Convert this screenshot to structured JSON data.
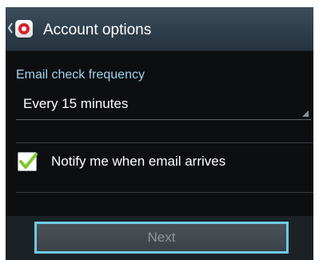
{
  "action_bar": {
    "title": "Account options",
    "back_icon": "chevron-left-icon",
    "app_icon": "email-app-icon"
  },
  "settings": {
    "email_check_frequency": {
      "label": "Email check frequency",
      "selected_value": "Every 15 minutes"
    },
    "notify_new_email": {
      "label": "Notify me when email arrives",
      "checked": true
    }
  },
  "footer": {
    "next_label": "Next",
    "next_enabled": false
  },
  "colors": {
    "accent": "#6ec9e6",
    "label_blue": "#9fd2ea",
    "check_green": "#7cc72e",
    "app_icon_red": "#d2232a"
  }
}
